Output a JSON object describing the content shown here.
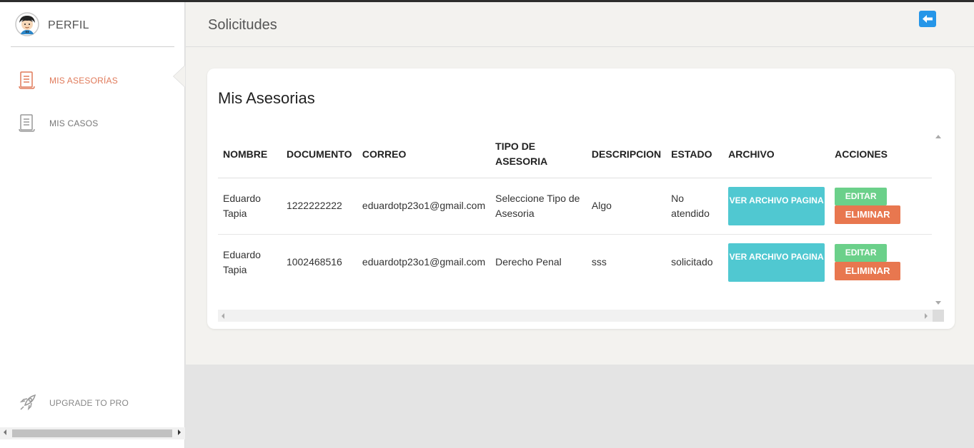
{
  "sidebar": {
    "profile_label": "PERFIL",
    "items": [
      {
        "label": "MIS ASESORÍAS",
        "icon": "document-icon",
        "active": true
      },
      {
        "label": "MIS CASOS",
        "icon": "document-icon",
        "active": false
      }
    ],
    "upgrade_label": "UPGRADE TO PRO",
    "upgrade_icon": "rocket-icon"
  },
  "header": {
    "title": "Solicitudes",
    "back_icon": "back-arrow-icon"
  },
  "card": {
    "title": "Mis Asesorias",
    "columns": [
      "NOMBRE",
      "DOCUMENTO",
      "CORREO",
      "TIPO DE ASESORIA",
      "DESCRIPCION",
      "ESTADO",
      "ARCHIVO",
      "ACCIONES"
    ],
    "rows": [
      {
        "nombre": "Eduardo Tapia",
        "documento": "1222222222",
        "correo": "eduardotp23o1@gmail.com",
        "tipo": "Seleccione Tipo de Asesoria",
        "descripcion": "Algo",
        "estado": "No atendido",
        "archivo_label": "VER ARCHIVO PAGINA",
        "edit_label": "EDITAR",
        "delete_label": "ELIMINAR"
      },
      {
        "nombre": "Eduardo Tapia",
        "documento": "1002468516",
        "correo": "eduardotp23o1@gmail.com",
        "tipo": "Derecho Penal",
        "descripcion": "sss",
        "estado": "solicitado",
        "archivo_label": "VER ARCHIVO PAGINA",
        "edit_label": "EDITAR",
        "delete_label": "ELIMINAR"
      }
    ]
  },
  "colors": {
    "active_nav": "#e07a5a",
    "archivo_button": "#50c8d1",
    "edit_button": "#6bd08a",
    "delete_button": "#e8774f",
    "back_button": "#2596e8"
  }
}
